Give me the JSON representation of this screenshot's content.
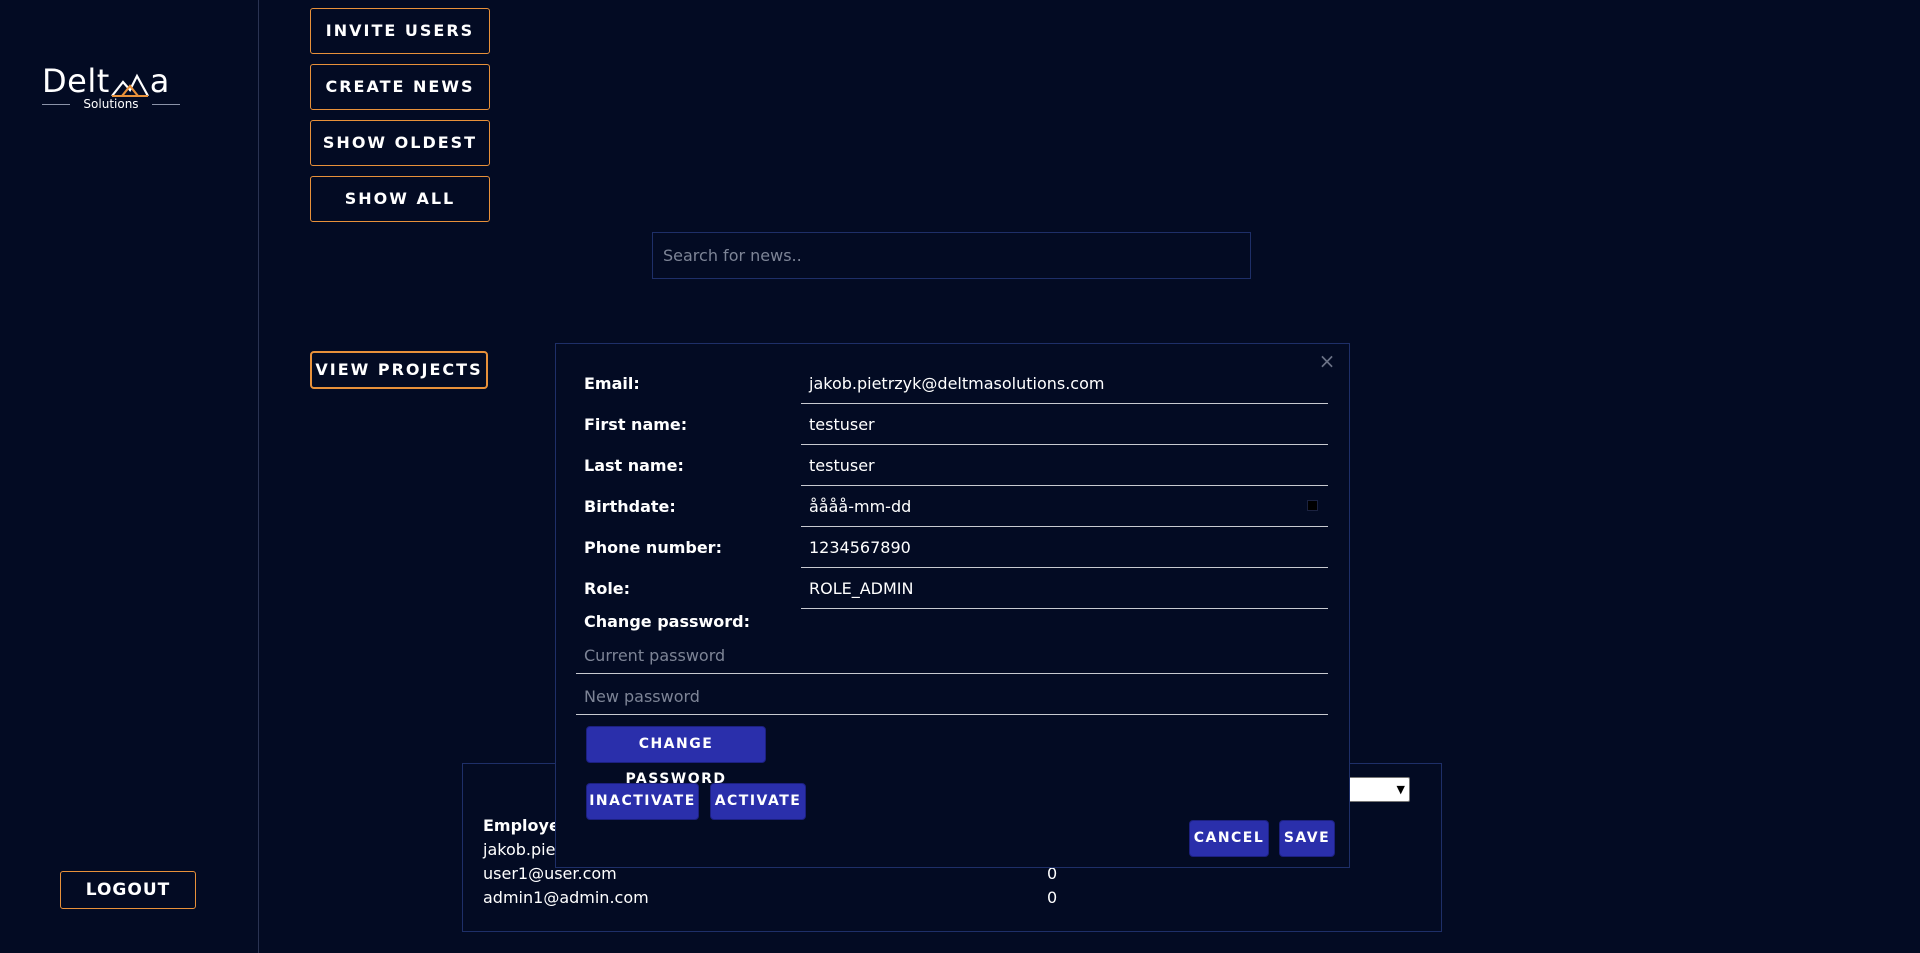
{
  "brand": {
    "name_left": "Delt",
    "name_right": "a",
    "subtitle": "Solutions",
    "accent": "#e8913a"
  },
  "sidebar": {
    "logout_label": "LOGOUT"
  },
  "actions": {
    "invite_users": "INVITE USERS",
    "create_news": "CREATE NEWS",
    "show_oldest": "SHOW OLDEST",
    "show_all": "SHOW ALL",
    "view_projects": "VIEW PROJECTS"
  },
  "search": {
    "placeholder": "Search for news.."
  },
  "table": {
    "header": "Employee",
    "rows": [
      {
        "email": "jakob.piet",
        "value": ""
      },
      {
        "email": "user1@user.com",
        "value": "0"
      },
      {
        "email": "admin1@admin.com",
        "value": "0"
      }
    ]
  },
  "modal": {
    "close_icon": "×",
    "fields": [
      {
        "label": "Email:",
        "value": "jakob.pietrzyk@deltmasolutions.com"
      },
      {
        "label": "First name:",
        "value": "testuser"
      },
      {
        "label": "Last name:",
        "value": "testuser"
      },
      {
        "label": "Birthdate:",
        "value": "åååå-mm-dd"
      },
      {
        "label": "Phone number:",
        "value": "1234567890"
      },
      {
        "label": "Role:",
        "value": "ROLE_ADMIN"
      }
    ],
    "change_password_label": "Change password:",
    "current_password_placeholder": "Current password",
    "new_password_placeholder": "New password",
    "change_password_button": "CHANGE PASSWORD",
    "inactivate_button": "INACTIVATE",
    "activate_button": "ACTIVATE",
    "cancel_button": "CANCEL",
    "save_button": "SAVE"
  }
}
